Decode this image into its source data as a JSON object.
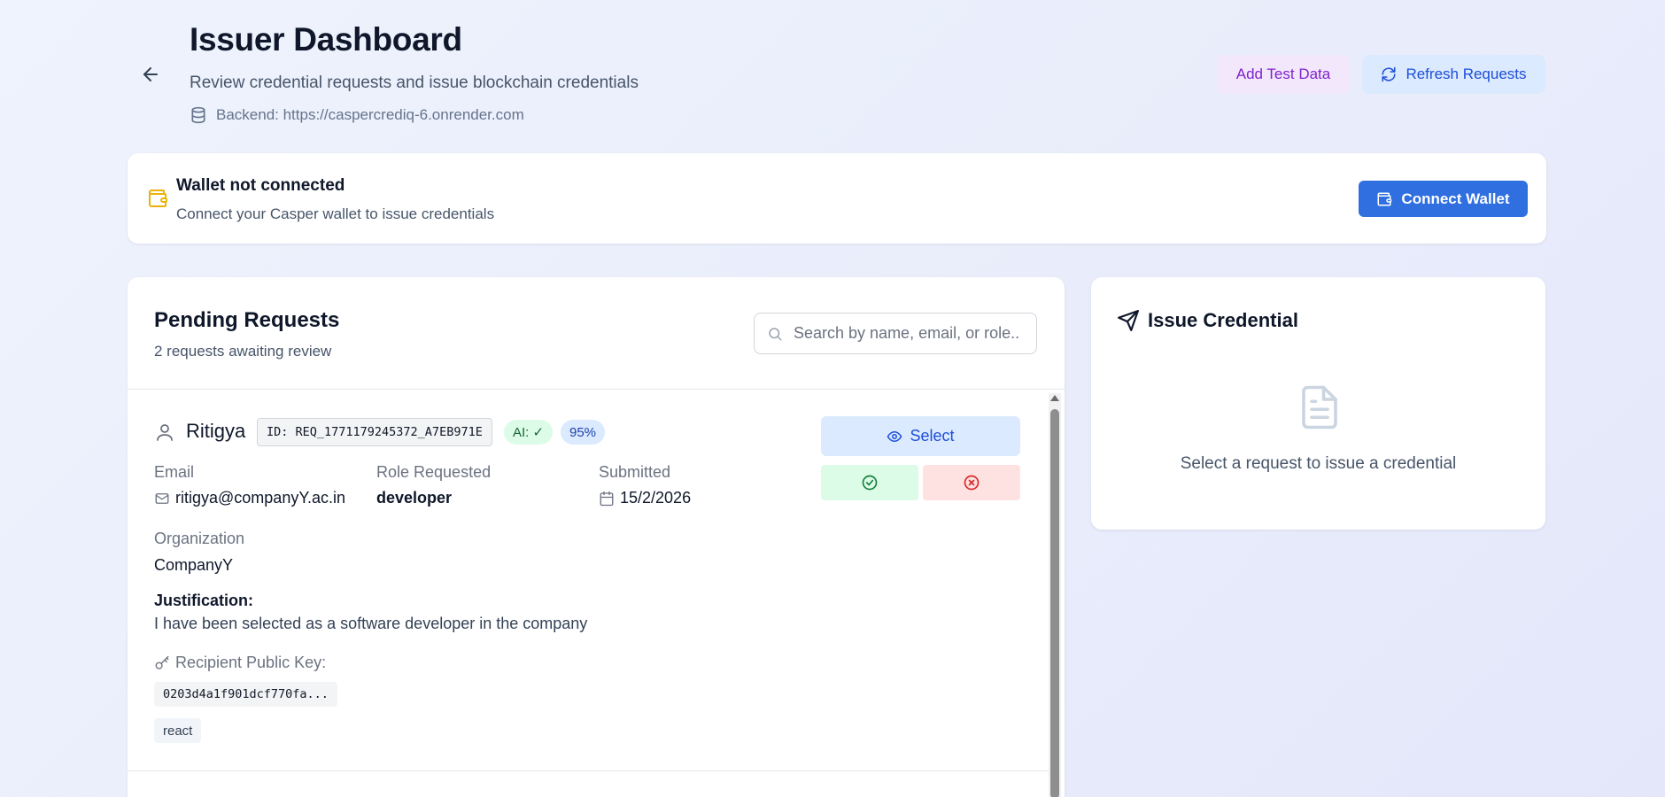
{
  "header": {
    "title": "Issuer Dashboard",
    "subtitle": "Review credential requests and issue blockchain credentials",
    "backend_label": "Backend: https://caspercrediq-6.onrender.com",
    "add_test_data_label": "Add Test Data",
    "refresh_label": "Refresh Requests"
  },
  "wallet": {
    "title": "Wallet not connected",
    "description": "Connect your Casper wallet to issue credentials",
    "connect_label": "Connect Wallet"
  },
  "pending": {
    "title": "Pending Requests",
    "subtitle": "2 requests awaiting review",
    "search_placeholder": "Search by name, email, or role...",
    "requests": [
      {
        "name": "Ritigya",
        "id_label": "ID: REQ_1771179245372_A7EB971E",
        "ai_badge": "AI: ✓",
        "score_badge": "95%",
        "email_label": "Email",
        "email": "ritigya@companyY.ac.in",
        "role_label": "Role Requested",
        "role": "developer",
        "submitted_label": "Submitted",
        "submitted": "15/2/2026",
        "org_label": "Organization",
        "org": "CompanyY",
        "justification_label": "Justification:",
        "justification": "I have been selected as a software developer in the company",
        "pubkey_label": "Recipient Public Key:",
        "pubkey": "0203d4a1f901dcf770fa...",
        "skill": "react",
        "select_label": "Select"
      }
    ]
  },
  "issue": {
    "title": "Issue Credential",
    "empty_text": "Select a request to issue a credential"
  },
  "colors": {
    "primary": "#2f6fe0",
    "approve_bg": "#dcfce7",
    "reject_bg": "#fee2e2",
    "wallet_warning": "#eab308"
  }
}
